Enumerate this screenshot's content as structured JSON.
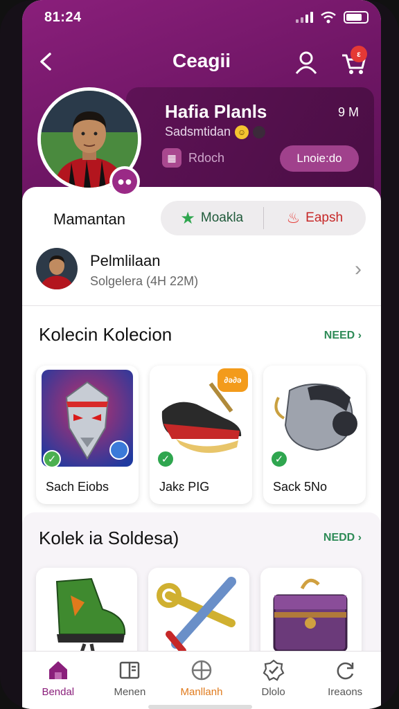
{
  "status": {
    "time": "81:24"
  },
  "nav": {
    "title": "Ceagii",
    "cart_badge": "ε"
  },
  "profile": {
    "name": "Hafia Planls",
    "count": "9 M",
    "subtitle": "Sadsmtidan",
    "chip_label": "Rdoch",
    "button_label": "Lnoie:do"
  },
  "segment": {
    "label": "Mamantan",
    "option_1": "Moakla",
    "option_2": "Eapsh"
  },
  "person": {
    "name": "Pelmlilaan",
    "subtitle": "Solgelera (4H 22M)"
  },
  "section1": {
    "title": "Kolecin Kolecion",
    "link": "NEED ›",
    "items": [
      {
        "label": "Sach Eiobs"
      },
      {
        "label": "Jakɛ PIG",
        "tag": "∂ə∂ə"
      },
      {
        "label": "Sack 5No"
      }
    ]
  },
  "section2": {
    "title": "Kolek ia Soldesa)",
    "link": "NEDD ›"
  },
  "tabs": [
    {
      "label": "Bendal",
      "icon": "home-icon"
    },
    {
      "label": "Menen",
      "icon": "book-icon"
    },
    {
      "label": "Manllanh",
      "icon": "target-icon"
    },
    {
      "label": "Dlolo",
      "icon": "check-badge-icon"
    },
    {
      "label": "Ireaons",
      "icon": "refresh-icon"
    }
  ],
  "colors": {
    "brand": "#8a1f7b",
    "accent_green": "#2e8b57",
    "accent_orange": "#e07a1c"
  }
}
